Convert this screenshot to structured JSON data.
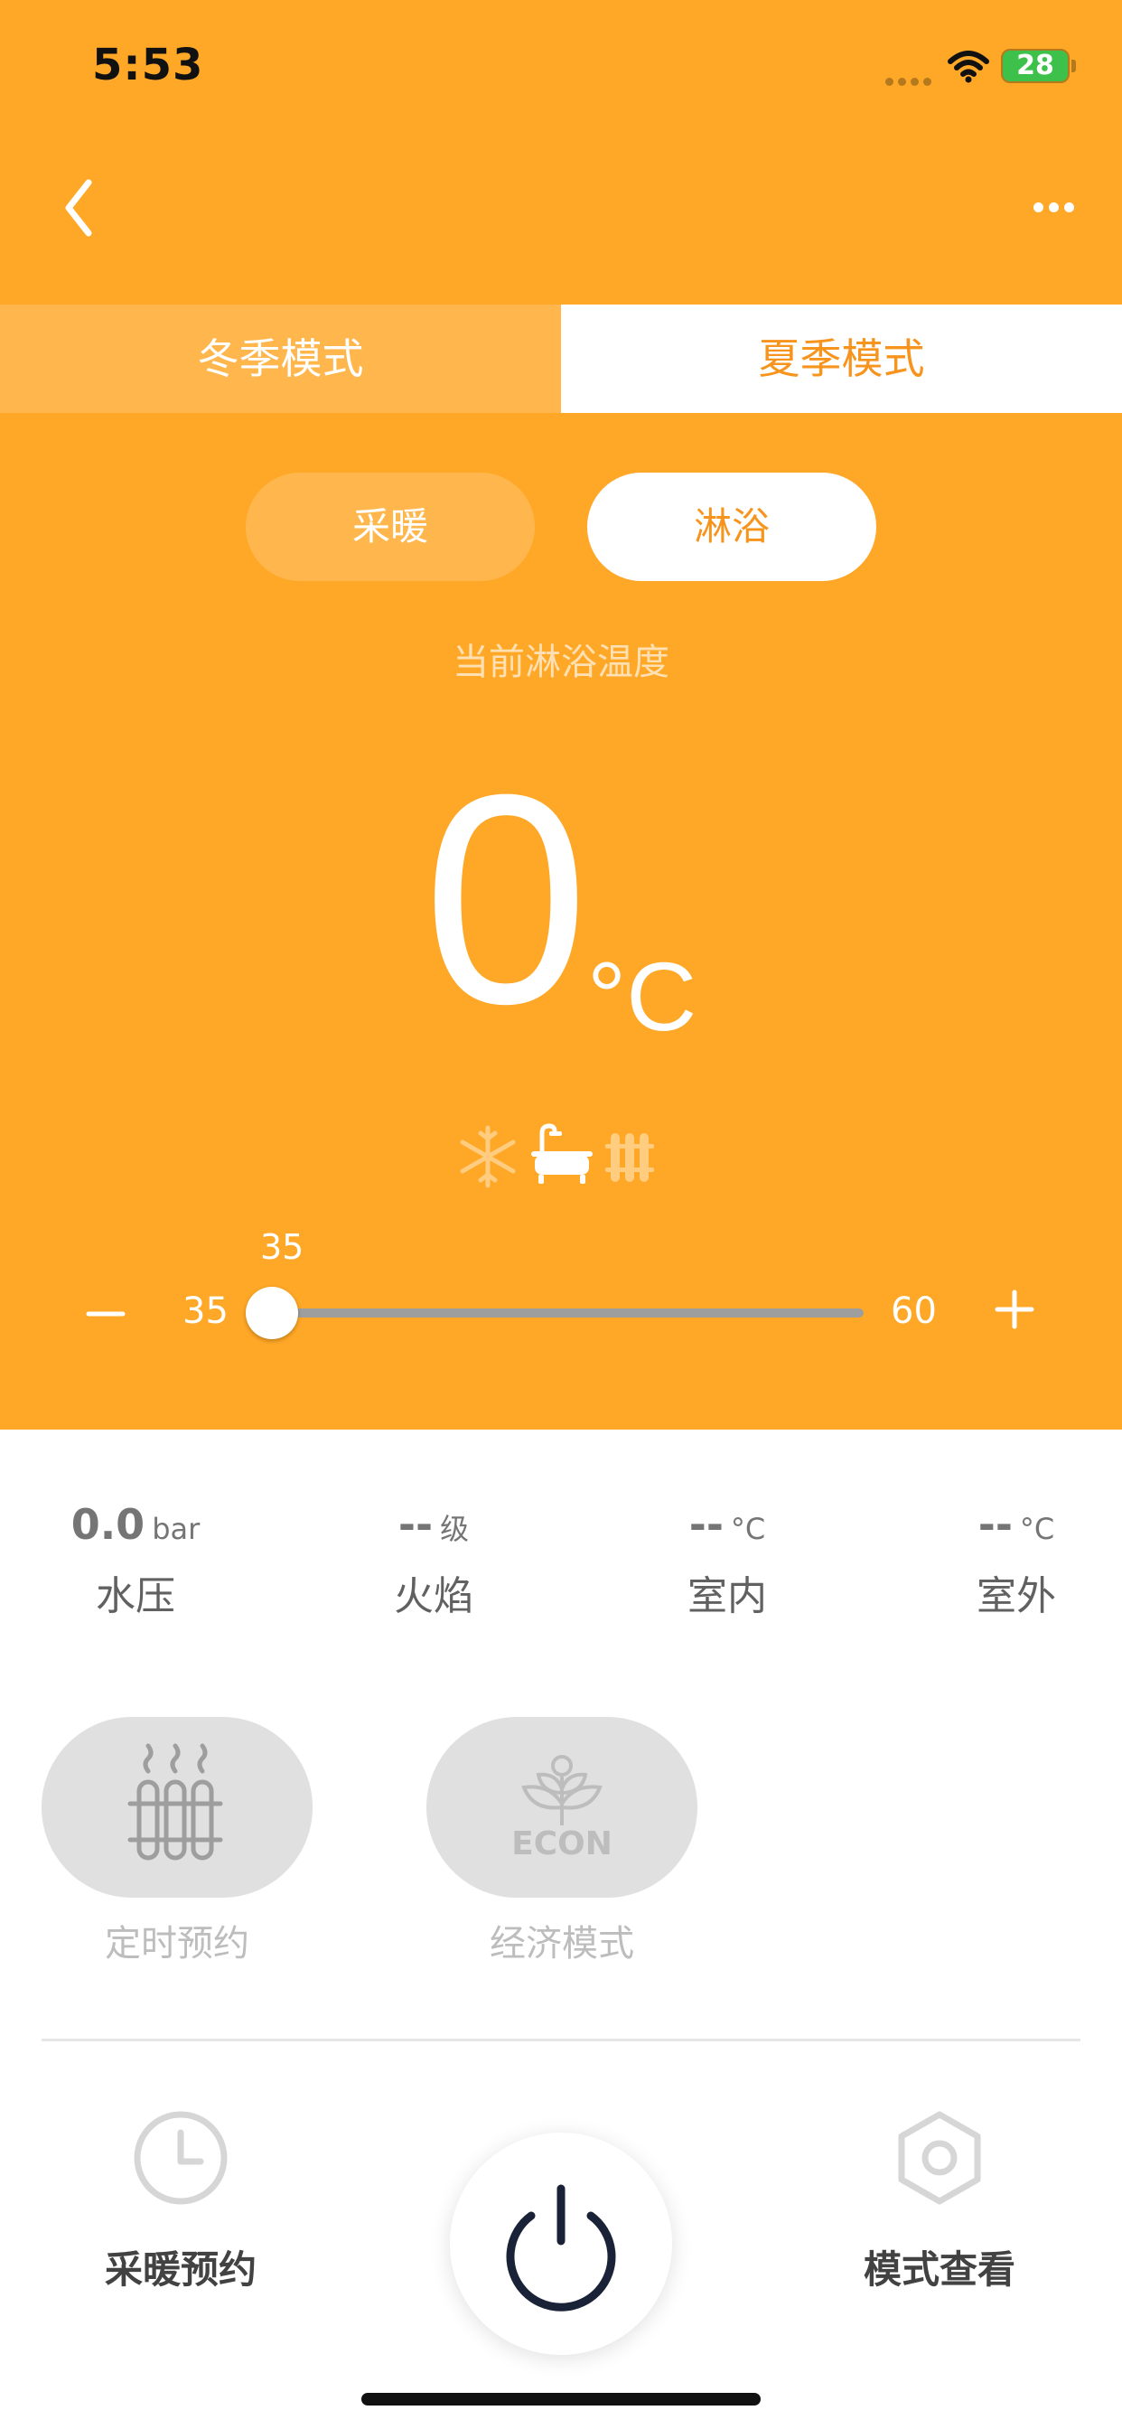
{
  "status_bar": {
    "time": "5:53",
    "battery": "28"
  },
  "header": {
    "back_icon": "chevron-left-icon",
    "more_icon": "more-dots-icon"
  },
  "season_tabs": [
    {
      "label": "冬季模式",
      "selected": false
    },
    {
      "label": "夏季模式",
      "selected": true
    }
  ],
  "mode_pills": [
    {
      "label": "采暖",
      "selected": false
    },
    {
      "label": "淋浴",
      "selected": true
    }
  ],
  "temperature": {
    "caption": "当前淋浴温度",
    "value": "0",
    "unit": "°C",
    "status_icons": [
      "snowflake-icon",
      "bathtub-icon",
      "radiator-icon"
    ]
  },
  "slider": {
    "value": "35",
    "min": "35",
    "max": "60",
    "minus_icon": "minus-icon",
    "plus_icon": "plus-icon"
  },
  "stats": [
    {
      "value": "0.0",
      "unit": "bar",
      "label": "水压"
    },
    {
      "value": "--",
      "unit": "级",
      "label": "火焰"
    },
    {
      "value": "--",
      "unit": "°C",
      "label": "室内"
    },
    {
      "value": "--",
      "unit": "°C",
      "label": "室外"
    }
  ],
  "functions": [
    {
      "label": "定时预约",
      "icon": "radiator-heat-icon"
    },
    {
      "label": "经济模式",
      "icon": "econ-icon",
      "icon_text": "ECON"
    }
  ],
  "bottom_nav": {
    "left_label": "采暖预约",
    "left_icon": "clock-icon",
    "right_label": "模式查看",
    "right_icon": "hexagon-nut-icon",
    "center_icon": "power-icon"
  },
  "colors": {
    "primary": "#FFA726",
    "accent": "#F7941D",
    "power": "#1a2238"
  }
}
